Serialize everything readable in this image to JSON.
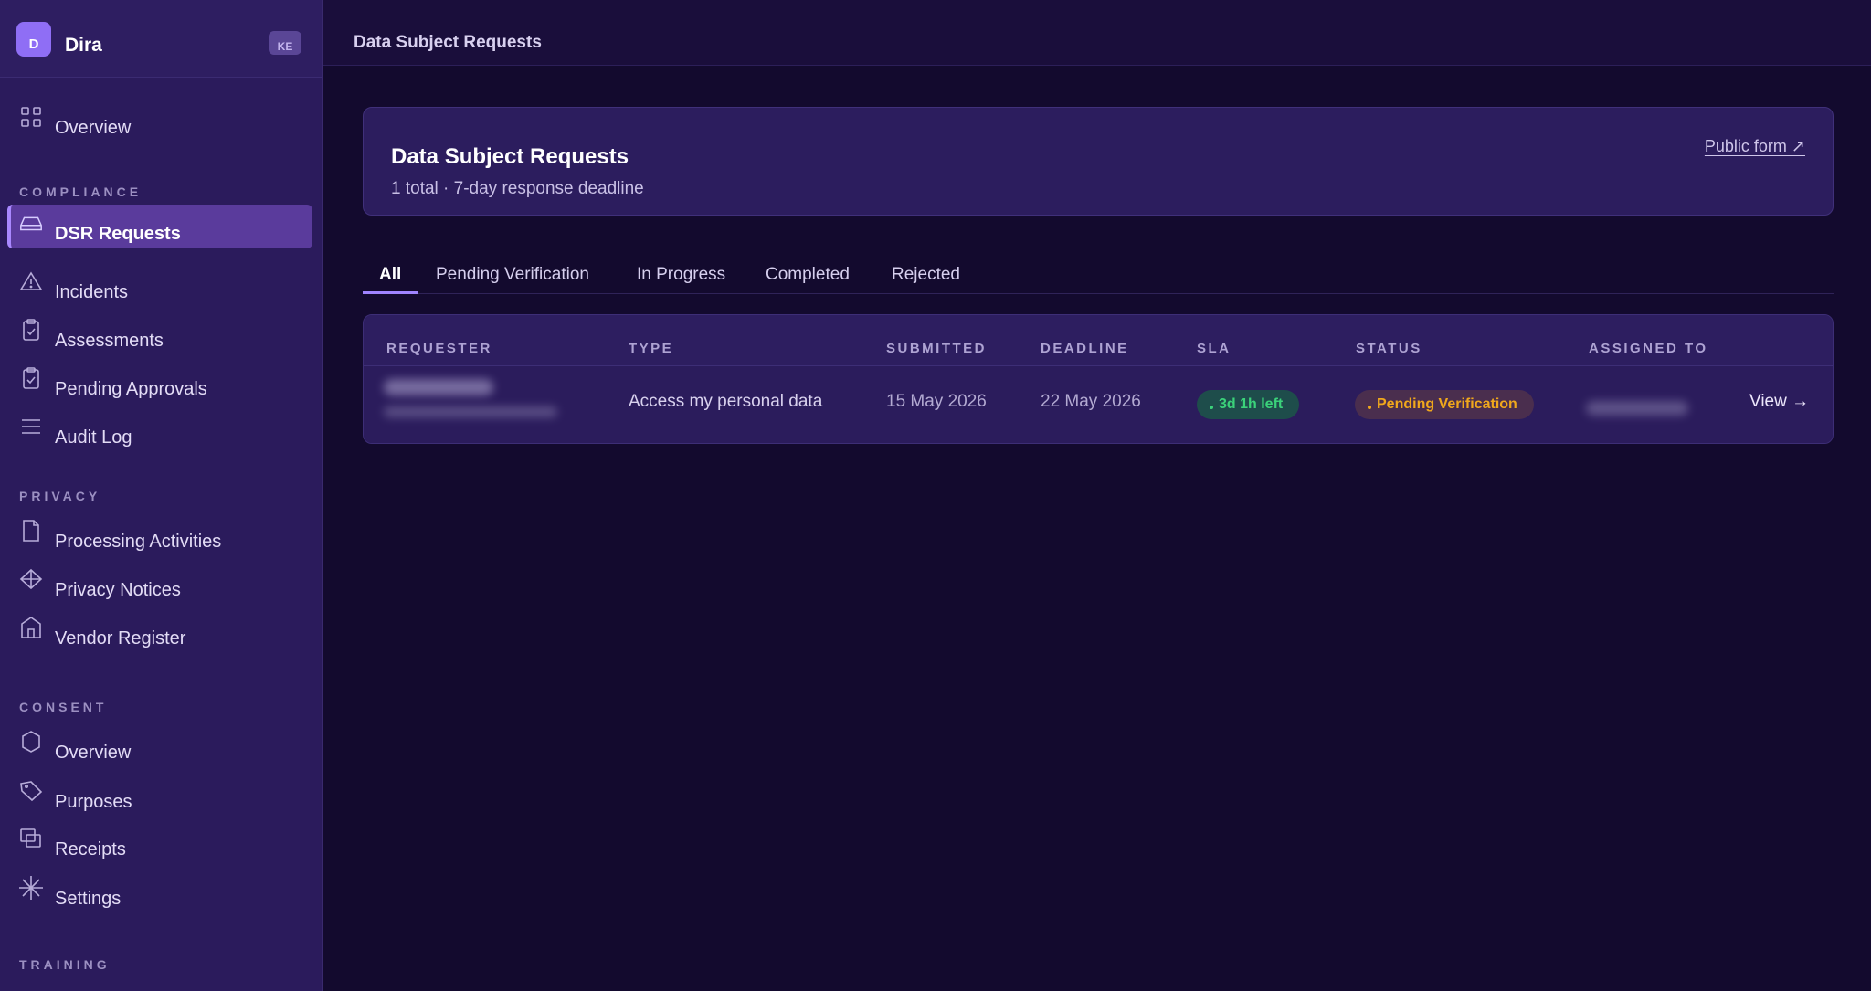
{
  "brand": {
    "logo_letter": "D",
    "name": "Dira",
    "badge": "KE"
  },
  "nav": {
    "overview": {
      "label": "Overview",
      "icon": "grid-icon"
    },
    "sections": {
      "compliance": "COMPLIANCE",
      "privacy": "PRIVACY",
      "consent": "CONSENT",
      "training": "TRAINING"
    },
    "compliance_items": [
      {
        "label": "DSR Requests",
        "icon": "inbox-icon",
        "active": true
      },
      {
        "label": "Incidents",
        "icon": "warning-icon"
      },
      {
        "label": "Assessments",
        "icon": "clipboard-check-icon"
      },
      {
        "label": "Pending Approvals",
        "icon": "clipboard-check-icon"
      },
      {
        "label": "Audit Log",
        "icon": "list-icon"
      }
    ],
    "privacy_items": [
      {
        "label": "Processing Activities",
        "icon": "file-icon"
      },
      {
        "label": "Privacy Notices",
        "icon": "diamond-icon"
      },
      {
        "label": "Vendor Register",
        "icon": "building-icon"
      }
    ],
    "consent_items": [
      {
        "label": "Overview",
        "icon": "hexagon-icon"
      },
      {
        "label": "Purposes",
        "icon": "tag-icon"
      },
      {
        "label": "Receipts",
        "icon": "copy-icon"
      },
      {
        "label": "Settings",
        "icon": "asterisk-icon"
      }
    ]
  },
  "topbar": {
    "title": "Data Subject Requests"
  },
  "header": {
    "title": "Data Subject Requests",
    "subtitle": "1 total · 7-day response deadline",
    "public_form": "Public form ↗"
  },
  "tabs": [
    "All",
    "Pending Verification",
    "In Progress",
    "Completed",
    "Rejected"
  ],
  "table": {
    "columns": [
      "REQUESTER",
      "TYPE",
      "SUBMITTED",
      "DEADLINE",
      "SLA",
      "STATUS",
      "ASSIGNED TO"
    ],
    "rows": [
      {
        "type": "Access my personal data",
        "submitted": "15 May 2026",
        "deadline": "22 May 2026",
        "sla": "3d 1h left",
        "status": "Pending Verification",
        "action": "View →"
      }
    ]
  },
  "colors": {
    "accent": "#8f6ef5",
    "sla_ok": "#3bd27a",
    "status_pending": "#f0a81c"
  }
}
